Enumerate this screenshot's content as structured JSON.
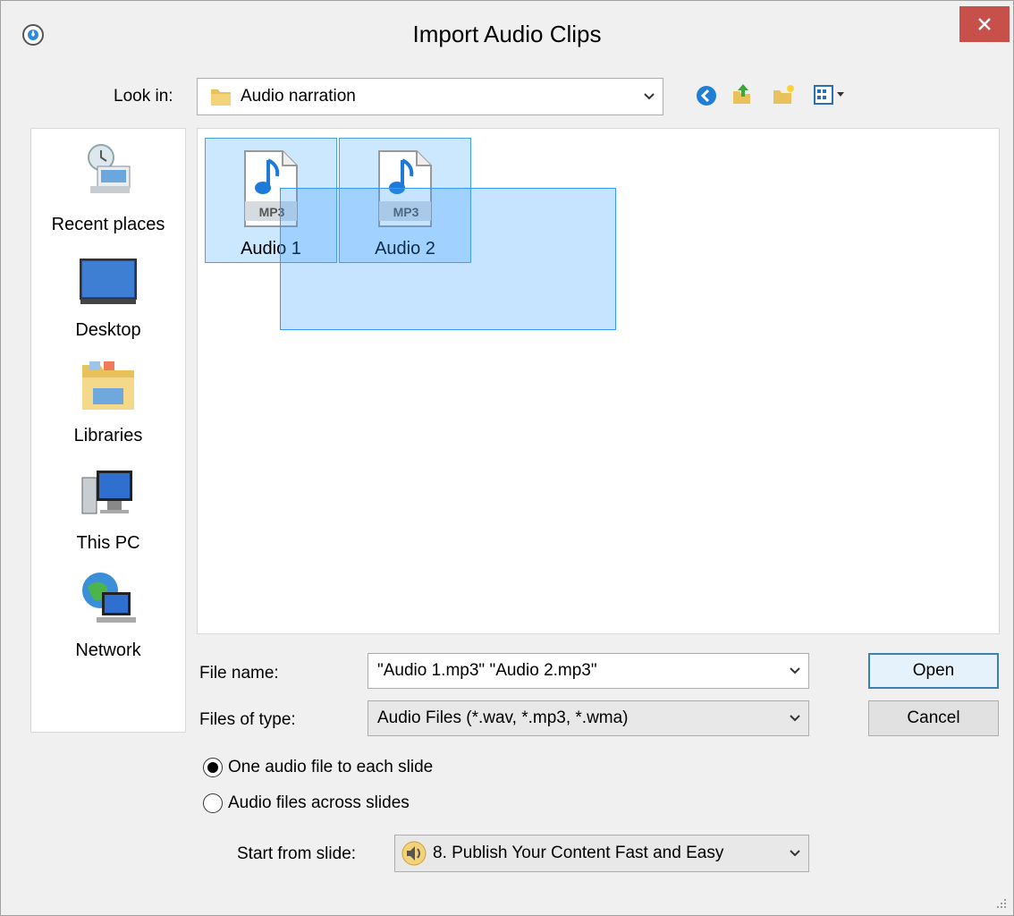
{
  "window": {
    "title": "Import Audio Clips"
  },
  "look_in": {
    "label": "Look in:",
    "value": "Audio narration"
  },
  "places": [
    {
      "label": "Recent places"
    },
    {
      "label": "Desktop"
    },
    {
      "label": "Libraries"
    },
    {
      "label": "This PC"
    },
    {
      "label": "Network"
    }
  ],
  "files": [
    {
      "name": "Audio 1",
      "type_badge": "MP3"
    },
    {
      "name": "Audio 2",
      "type_badge": "MP3"
    }
  ],
  "file_name": {
    "label": "File name:",
    "value": "\"Audio 1.mp3\" \"Audio 2.mp3\""
  },
  "file_type": {
    "label": "Files of type:",
    "value": "Audio Files (*.wav, *.mp3, *.wma)"
  },
  "buttons": {
    "open": "Open",
    "cancel": "Cancel"
  },
  "options": {
    "one_per_slide": "One audio file to each slide",
    "across_slides": "Audio files across slides",
    "selected": "one_per_slide"
  },
  "start_from": {
    "label": "Start from slide:",
    "value": "8. Publish Your Content Fast and Easy"
  },
  "colors": {
    "selection": "#cce8ff",
    "close": "#c7504a",
    "accent": "#3399ff"
  }
}
